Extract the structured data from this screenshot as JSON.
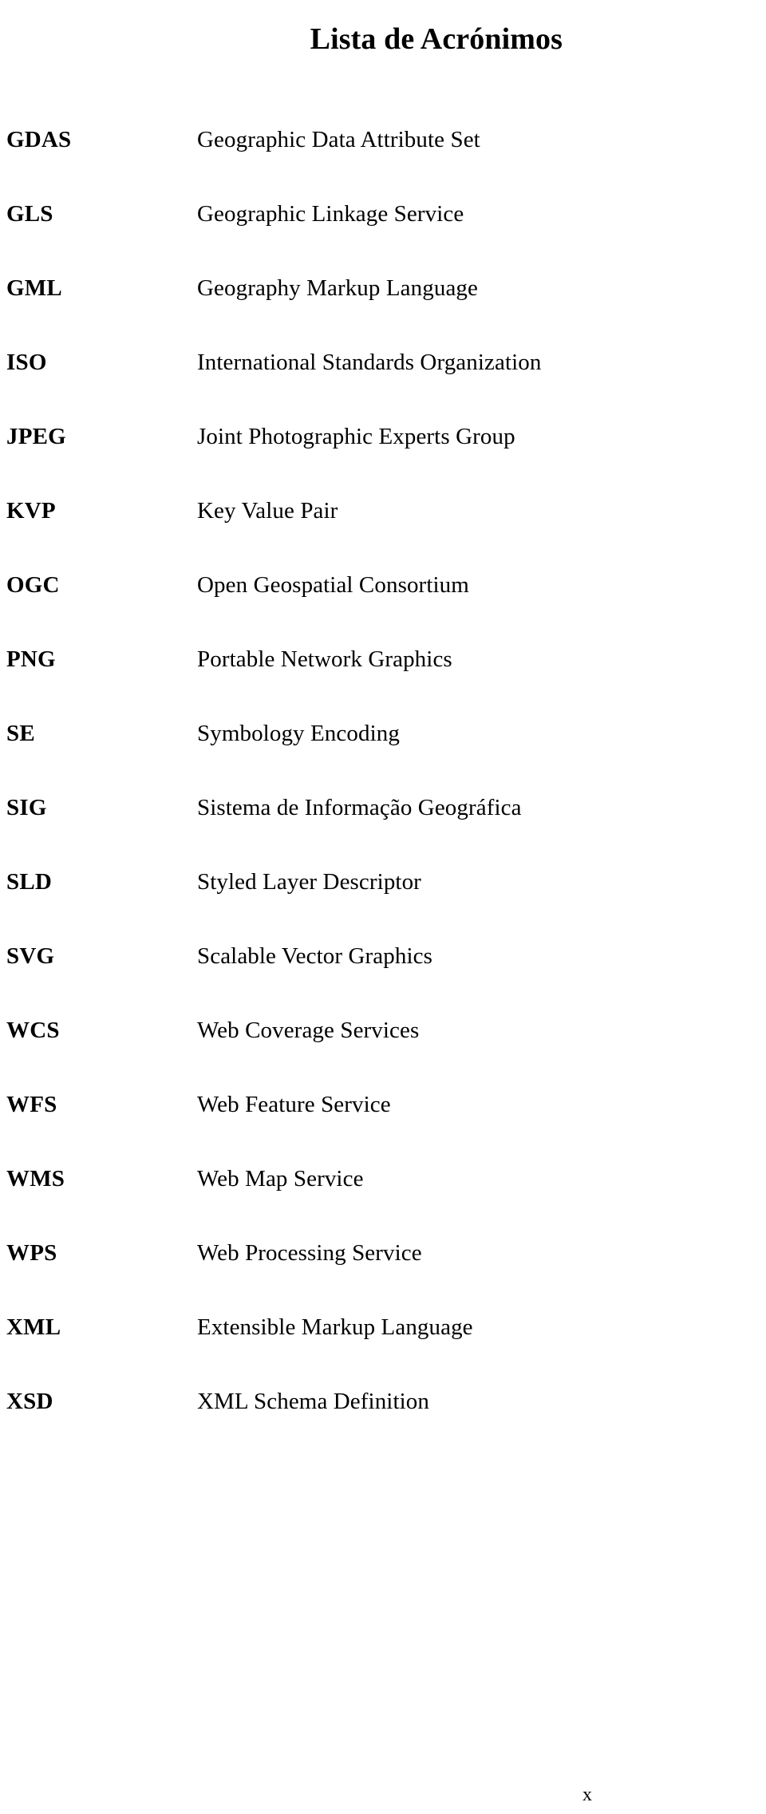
{
  "page": {
    "title": "Lista de Acrónimos",
    "page_number": "x",
    "background_color": "#ffffff",
    "text_color": "#000000"
  },
  "acronyms": [
    {
      "term": "GDAS",
      "definition": "Geographic Data Attribute Set"
    },
    {
      "term": "GLS",
      "definition": "Geographic Linkage Service"
    },
    {
      "term": "GML",
      "definition": "Geography Markup Language"
    },
    {
      "term": "ISO",
      "definition": "International Standards Organization"
    },
    {
      "term": "JPEG",
      "definition": "Joint Photographic Experts Group"
    },
    {
      "term": "KVP",
      "definition": "Key Value Pair"
    },
    {
      "term": "OGC",
      "definition": "Open Geospatial Consortium"
    },
    {
      "term": "PNG",
      "definition": "Portable Network Graphics"
    },
    {
      "term": "SE",
      "definition": "Symbology Encoding"
    },
    {
      "term": "SIG",
      "definition": "Sistema de Informação Geográfica"
    },
    {
      "term": "SLD",
      "definition": "Styled Layer Descriptor"
    },
    {
      "term": "SVG",
      "definition": "Scalable Vector Graphics"
    },
    {
      "term": "WCS",
      "definition": "Web Coverage Services"
    },
    {
      "term": "WFS",
      "definition": "Web Feature Service"
    },
    {
      "term": "WMS",
      "definition": "Web Map Service"
    },
    {
      "term": "WPS",
      "definition": "Web Processing Service"
    },
    {
      "term": "XML",
      "definition": "Extensible Markup Language"
    },
    {
      "term": "XSD",
      "definition": "XML Schema Definition"
    }
  ]
}
